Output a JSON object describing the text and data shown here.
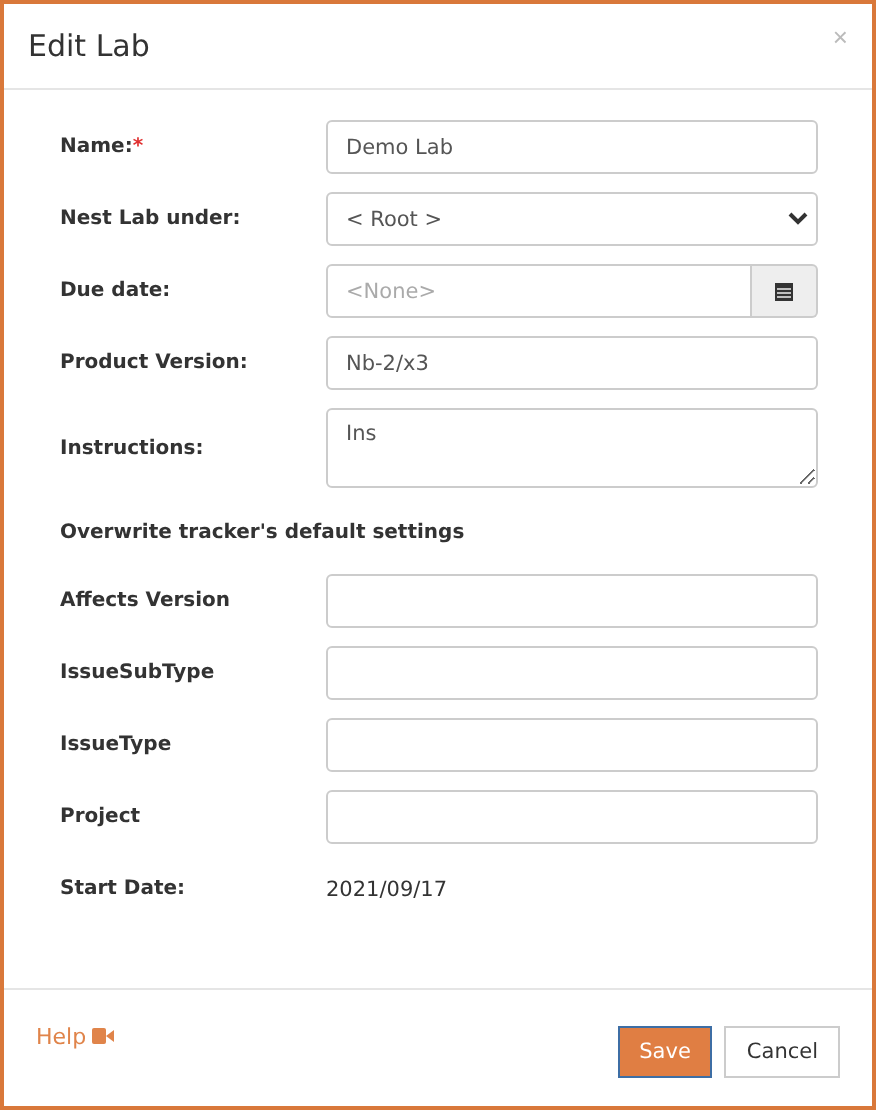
{
  "dialog": {
    "title": "Edit Lab",
    "close": "×"
  },
  "fields": [
    {
      "kind": "text",
      "label": "Name:",
      "required_mark": "*",
      "value": "Demo Lab"
    },
    {
      "kind": "select",
      "label": "Nest Lab under:",
      "value": "< Root >"
    },
    {
      "kind": "date",
      "label": "Due date:",
      "placeholder": "<None>"
    },
    {
      "kind": "text",
      "label": "Product Version:",
      "value": "Nb-2/x3"
    },
    {
      "kind": "textarea",
      "label": "Instructions:",
      "value": "Ins"
    },
    {
      "kind": "heading",
      "label": "Overwrite tracker's default settings"
    },
    {
      "kind": "text",
      "label": "Affects Version"
    },
    {
      "kind": "text",
      "label": "IssueSubType"
    },
    {
      "kind": "text",
      "label": "IssueType"
    },
    {
      "kind": "text",
      "label": "Project"
    },
    {
      "kind": "static",
      "label": "Start Date:",
      "value": "2021/09/17"
    }
  ],
  "footer": {
    "help": "Help",
    "buttons": [
      {
        "kind": "primary",
        "label": "Save"
      },
      {
        "kind": "default",
        "label": "Cancel"
      }
    ]
  }
}
